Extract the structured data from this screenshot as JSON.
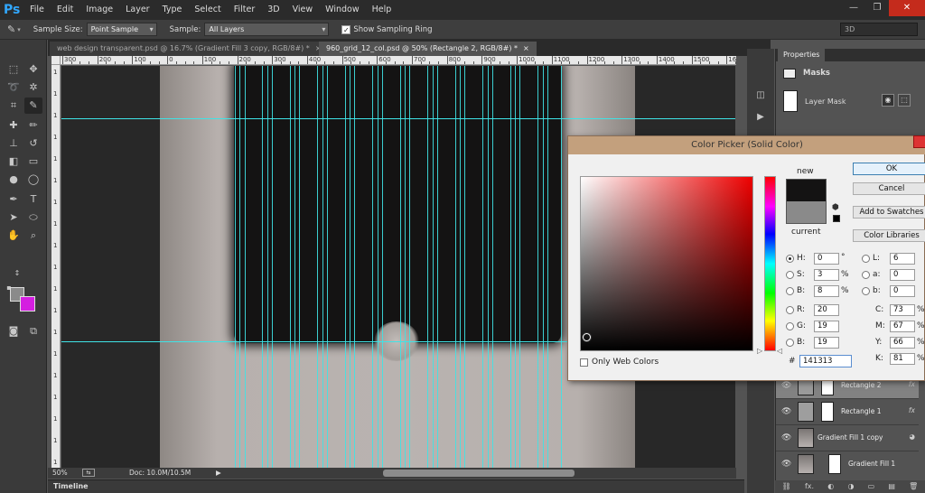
{
  "app": {
    "logo": "Ps"
  },
  "menu": [
    "File",
    "Edit",
    "Image",
    "Layer",
    "Type",
    "Select",
    "Filter",
    "3D",
    "View",
    "Window",
    "Help"
  ],
  "window_controls": {
    "minimize": "—",
    "restore": "❐",
    "close": "✕"
  },
  "options": {
    "sample_size_label": "Sample Size:",
    "sample_size_value": "Point Sample",
    "sample_label": "Sample:",
    "sample_value": "All Layers",
    "show_ring_label": "Show Sampling Ring",
    "workspace": "3D"
  },
  "tabs": [
    {
      "label": "web design transparent.psd @ 16.7% (Gradient Fill 3 copy, RGB/8#) *",
      "close": "×"
    },
    {
      "label": "960_grid_12_col.psd @ 50% (Rectangle 2, RGB/8#) *",
      "close": "×"
    }
  ],
  "ruler_h_labels": [
    "300",
    "200",
    "100",
    "0",
    "100",
    "200",
    "300",
    "400",
    "500",
    "600",
    "700",
    "800",
    "900",
    "1000",
    "1100",
    "1200",
    "1300",
    "1400",
    "1500",
    "1600"
  ],
  "ruler_v_labels": [
    "1",
    "1",
    "1",
    "1",
    "1",
    "1",
    "1",
    "1",
    "1",
    "1",
    "1",
    "1",
    "1",
    "1",
    "1",
    "1",
    "1",
    "1",
    "1"
  ],
  "status": {
    "zoom": "50%",
    "doc": "Doc: 10.0M/10.5M",
    "arrow": "▶"
  },
  "timeline_label": "Timeline",
  "properties": {
    "tab": "Properties",
    "masks_label": "Masks",
    "layer_mask_label": "Layer Mask"
  },
  "color_picker": {
    "title": "Color Picker (Solid Color)",
    "new_label": "new",
    "current_label": "current",
    "buttons": {
      "ok": "OK",
      "cancel": "Cancel",
      "add_swatches": "Add to Swatches",
      "libraries": "Color Libraries"
    },
    "fields": {
      "H": {
        "label": "H:",
        "value": "0",
        "unit": "°"
      },
      "S": {
        "label": "S:",
        "value": "3",
        "unit": "%"
      },
      "B": {
        "label": "B:",
        "value": "8",
        "unit": "%"
      },
      "R": {
        "label": "R:",
        "value": "20"
      },
      "G": {
        "label": "G:",
        "value": "19"
      },
      "Bl": {
        "label": "B:",
        "value": "19"
      },
      "L": {
        "label": "L:",
        "value": "6"
      },
      "a": {
        "label": "a:",
        "value": "0"
      },
      "b": {
        "label": "b:",
        "value": "0"
      },
      "C": {
        "label": "C:",
        "value": "73",
        "unit": "%"
      },
      "M": {
        "label": "M:",
        "value": "67",
        "unit": "%"
      },
      "Y": {
        "label": "Y:",
        "value": "66",
        "unit": "%"
      },
      "K": {
        "label": "K:",
        "value": "81",
        "unit": "%"
      }
    },
    "hash": "#",
    "hex": "141313",
    "web_colors_label": "Only Web Colors",
    "new_color": "#141313",
    "current_color": "#8a8a8a"
  },
  "layers": [
    {
      "name": "Rectangle 2",
      "fx": "fx"
    },
    {
      "name": "Rectangle 1",
      "fx": "fx"
    },
    {
      "name": "Gradient Fill 1 copy"
    },
    {
      "name": "Gradient Fill 1"
    }
  ],
  "layers_footer": [
    "⛓",
    "fx.",
    "◐",
    "◑",
    "▭",
    "▤",
    "🗑"
  ],
  "colors": {
    "guide": "#3fe3e6",
    "background_swatch": "#d41ee0",
    "foreground_swatch": "#8a8a8a"
  }
}
